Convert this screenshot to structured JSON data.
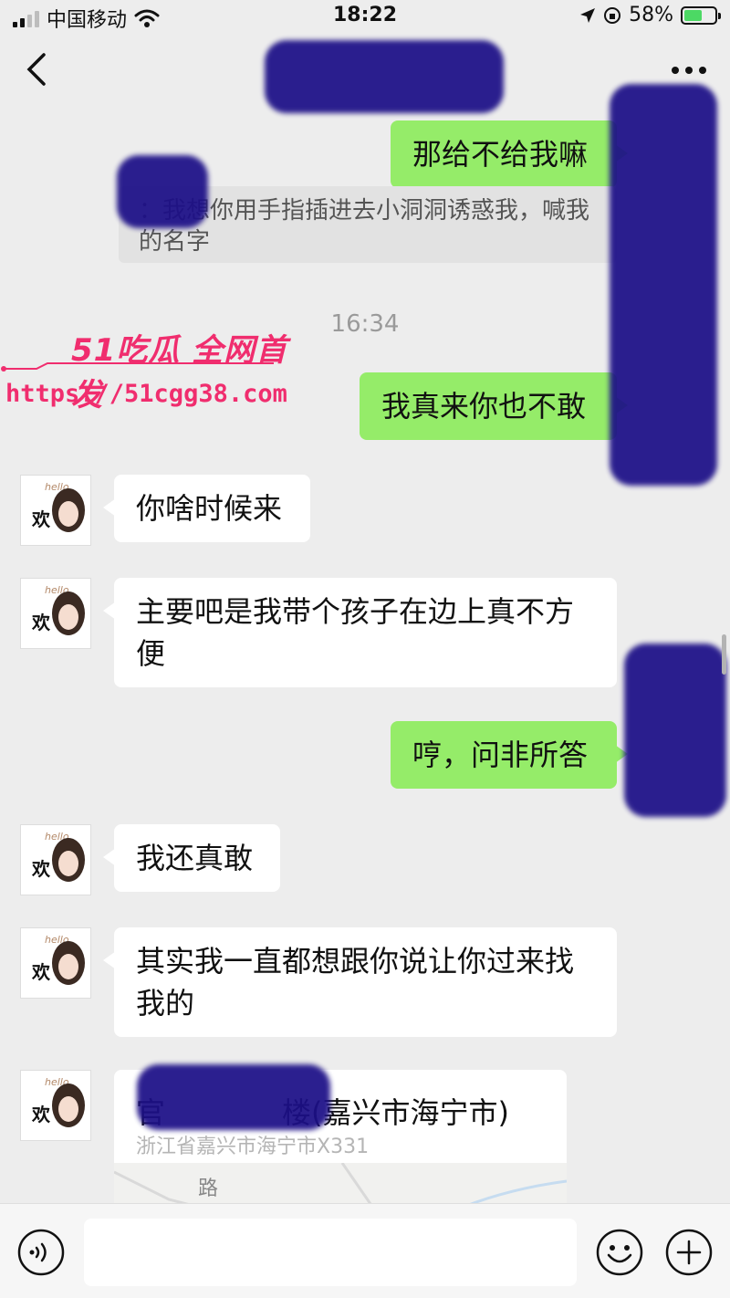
{
  "status_bar": {
    "carrier": "中国移动",
    "time": "18:22",
    "battery": "58%",
    "battery_level": 0.58
  },
  "navbar": {
    "title": ""
  },
  "messages": [
    {
      "side": "sent",
      "text": "那给不给我嘛"
    },
    {
      "side": "quote",
      "text": "：我想你用手指插进去小洞洞诱惑我，喊我的名字"
    },
    {
      "side": "time",
      "text": "16:34"
    },
    {
      "side": "sent",
      "text": "我真来你也不敢"
    },
    {
      "side": "recv",
      "text": "你啥时候来"
    },
    {
      "side": "recv",
      "text": "主要吧是我带个孩子在边上真不方便"
    },
    {
      "side": "sent",
      "text": "哼，问非所答"
    },
    {
      "side": "recv",
      "text": "我还真敢"
    },
    {
      "side": "recv",
      "text": "其实我一直都想跟你说让你过来找我的"
    }
  ],
  "location": {
    "title": "官　　　　楼(嘉兴市海宁市)",
    "address": "浙江省嘉兴市海宁市X331",
    "map_label": "路"
  },
  "avatar": {
    "badge": "欢",
    "script": "hello"
  },
  "watermark": {
    "brand": "51吃瓜 全网首发",
    "url": "https://51cgg38.com"
  },
  "icons": {
    "back": "chevron-left-icon",
    "more": "more-dots-icon",
    "voice": "voice-icon",
    "emoji": "emoji-icon",
    "add": "plus-icon"
  },
  "colors": {
    "sent_bubble": "#95ec69",
    "recv_bubble": "#ffffff",
    "background": "#ededed",
    "redaction": "#1c0f87",
    "watermark": "#f02d6e"
  }
}
